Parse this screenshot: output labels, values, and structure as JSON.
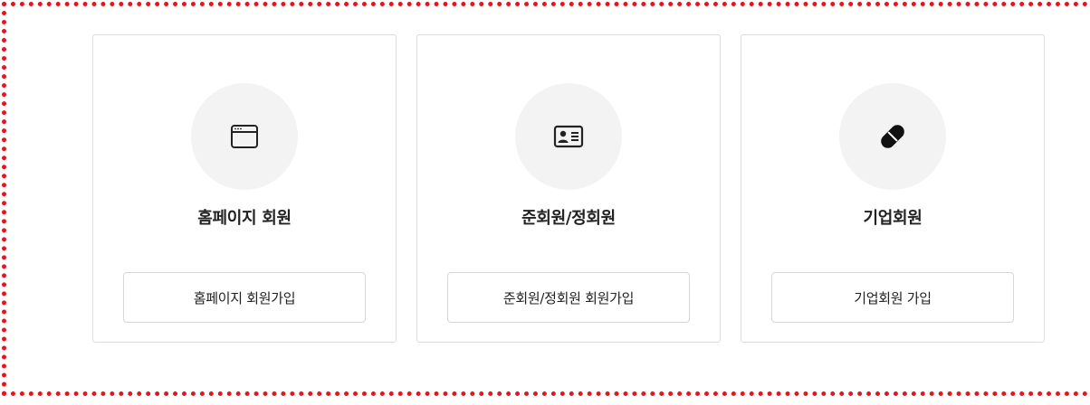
{
  "cards": [
    {
      "icon": "browser-window-icon",
      "title": "홈페이지 회원",
      "button_label": "홈페이지 회원가입"
    },
    {
      "icon": "id-card-icon",
      "title": "준회원/정회원",
      "button_label": "준회원/정회원 회원가입"
    },
    {
      "icon": "pill-capsule-icon",
      "title": "기업회원",
      "button_label": "기업회원 가입"
    }
  ],
  "colors": {
    "frame_border": "#e8141c",
    "card_border": "#dcdcdc",
    "icon_circle_bg": "#f3f3f3",
    "text": "#222222"
  }
}
